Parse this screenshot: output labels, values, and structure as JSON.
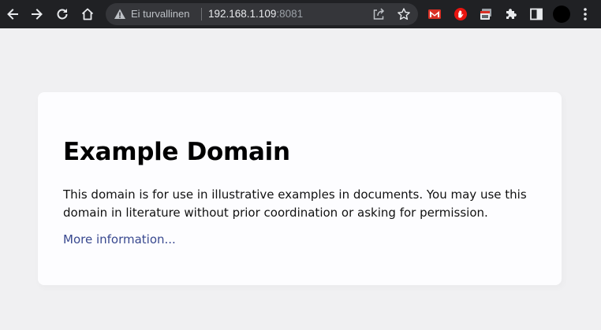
{
  "browser": {
    "security_label": "Ei turvallinen",
    "url_host": "192.168.1.109",
    "url_port": ":8081",
    "icons": {
      "back": "back-arrow-icon",
      "forward": "forward-arrow-icon",
      "reload": "reload-icon",
      "home": "home-icon",
      "warning": "warning-triangle-icon",
      "share": "share-icon",
      "bookmark": "star-icon",
      "ext_gmail": "gmail-icon",
      "ext_adblock": "adblock-hand-icon",
      "ext_tab": "tab-window-icon",
      "extensions": "puzzle-icon",
      "sidepanel": "side-panel-icon",
      "profile": "profile-avatar",
      "menu": "kebab-menu-icon"
    },
    "colors": {
      "toolbar_bg": "#202124",
      "omnibox_bg": "#35363a",
      "text": "#e8eaed"
    }
  },
  "page": {
    "title": "Example Domain",
    "description": "This domain is for use in illustrative examples in documents. You may use this domain in literature without prior coordination or asking for permission.",
    "link_text": "More information...",
    "colors": {
      "background": "#f0f0f2",
      "card": "#fdfdff",
      "link": "#38488f"
    }
  }
}
